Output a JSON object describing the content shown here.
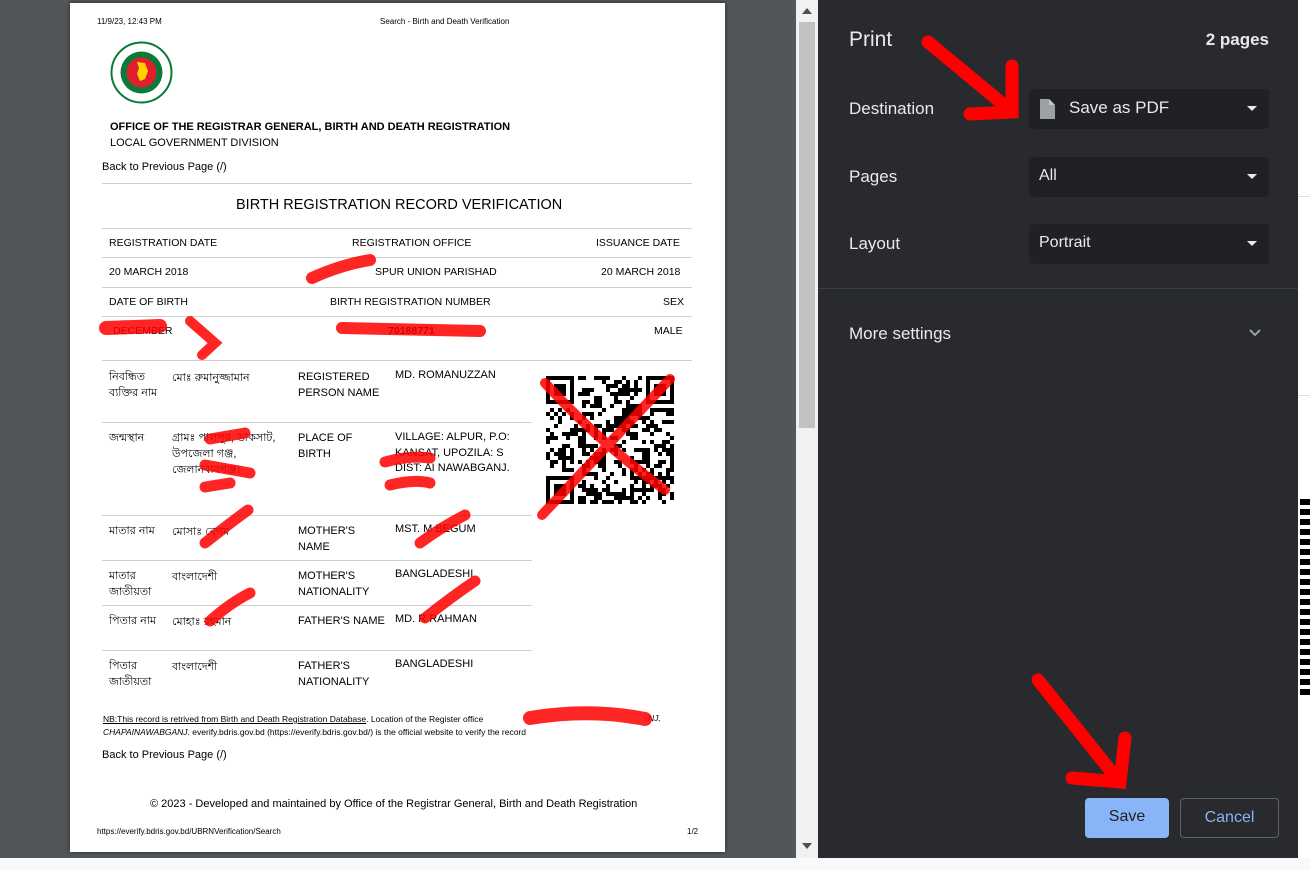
{
  "print_header": {
    "datetime": "11/9/23, 12:43 PM",
    "page_title": "Search - Birth and Death Verification",
    "footer_url": "https://everify.bdris.gov.bd/UBRNVerification/Search",
    "page_number": "1/2"
  },
  "document": {
    "office_title": "OFFICE OF THE REGISTRAR GENERAL, BIRTH AND DEATH REGISTRATION",
    "office_subtitle": "LOCAL GOVERNMENT DIVISION",
    "back_link": "Back to Previous Page (/)",
    "heading": "BIRTH REGISTRATION RECORD VERIFICATION",
    "summary_headers_1": [
      "REGISTRATION DATE",
      "REGISTRATION OFFICE",
      "ISSUANCE DATE"
    ],
    "summary_values_1": [
      "20 MARCH 2018",
      "SPUR UNION PARISHAD",
      "20 MARCH 2018"
    ],
    "summary_headers_2": [
      "DATE OF BIRTH",
      "BIRTH REGISTRATION NUMBER",
      "SEX"
    ],
    "summary_values_2": [
      "DECEMBER",
      "70188771",
      "MALE"
    ],
    "rows": [
      {
        "bn_label": "নিবন্ধিত ব্যক্তির নাম",
        "bn_value": "মোঃ রুমানুজ্জামান",
        "en_label": "REGISTERED PERSON NAME",
        "en_value": "MD. ROMANUZZAN"
      },
      {
        "bn_label": "জন্মস্থান",
        "bn_value": "গ্রামঃ পালপুর, ডাকসাট, উপজেলা গঞ্জ, জেলানবাবগঞ্জ।",
        "en_label": "PLACE OF BIRTH",
        "en_value": "VILLAGE: ALPUR, P.O: KANSAT, UPOZILA: S DIST: AI NAWABGANJ."
      },
      {
        "bn_label": "মাতার নাম",
        "bn_value": "মোসাঃ বেগম",
        "en_label": "MOTHER'S NAME",
        "en_value": "MST. M BEGUM"
      },
      {
        "bn_label": "মাতার জাতীয়তা",
        "bn_value": "বাংলাদেশী",
        "en_label": "MOTHER'S NATIONALITY",
        "en_value": "BANGLADESHI"
      },
      {
        "bn_label": "পিতার নাম",
        "bn_value": "মোহাঃ রহমান",
        "en_label": "FATHER'S NAME",
        "en_value": "MD. R RAHMAN"
      },
      {
        "bn_label": "পিতার জাতীয়তা",
        "bn_value": "বাংলাদেশী",
        "en_label": "FATHER'S NATIONALITY",
        "en_value": "BANGLADESHI"
      }
    ],
    "note_link": "NB:This record is retrived from Birth and Death Registration Database",
    "note_text_1": ". Location of the Register office",
    "note_end": "NJ,",
    "note_italic": "CHAPAINAWABGANJ.",
    "note_text_2": " everify.bdris.gov.bd (https://everify.bdris.gov.bd/) is the official website to verify the record",
    "back_link_2": "Back to Previous Page (/)",
    "copyright": "© 2023 - Developed and maintained by Office of the Registrar General, Birth and Death Registration"
  },
  "print_panel": {
    "title": "Print",
    "page_count": "2 pages",
    "destination_label": "Destination",
    "destination_value": "Save as PDF",
    "pages_label": "Pages",
    "pages_value": "All",
    "layout_label": "Layout",
    "layout_value": "Portrait",
    "more_settings_label": "More settings",
    "save_label": "Save",
    "cancel_label": "Cancel"
  },
  "colors": {
    "panel_bg": "#292a2d",
    "select_bg": "#202124",
    "save_bg": "#8ab4f8",
    "save_text": "#202124",
    "cancel_text": "#8ab4f8",
    "annotation_red": "#ff0000"
  }
}
